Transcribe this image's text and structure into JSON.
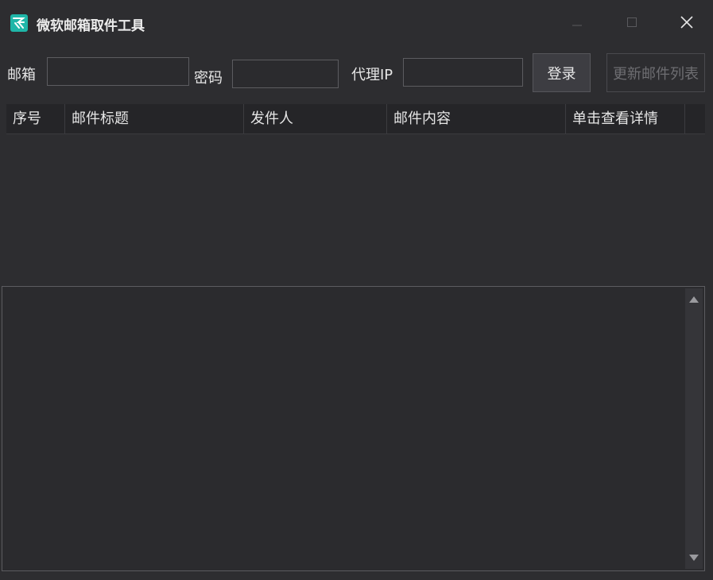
{
  "window": {
    "title": "微软邮箱取件工具",
    "icon": "app-logo-icon",
    "controls": [
      "minimize-icon",
      "maximize-icon",
      "close-icon"
    ]
  },
  "form": {
    "email_label": "邮箱",
    "email_value": "",
    "password_label": "密码",
    "password_value": "",
    "proxy_label": "代理IP",
    "proxy_value": "",
    "login_label": "登录",
    "refresh_label": "更新邮件列表"
  },
  "table": {
    "columns": [
      "序号",
      "邮件标题",
      "发件人",
      "邮件内容",
      "单击查看详情"
    ],
    "rows": []
  },
  "log": {
    "content": ""
  },
  "colors": {
    "background": "#2d2d30",
    "accent_icon": "#1fb6a8",
    "disabled_text": "#6e6e72"
  }
}
